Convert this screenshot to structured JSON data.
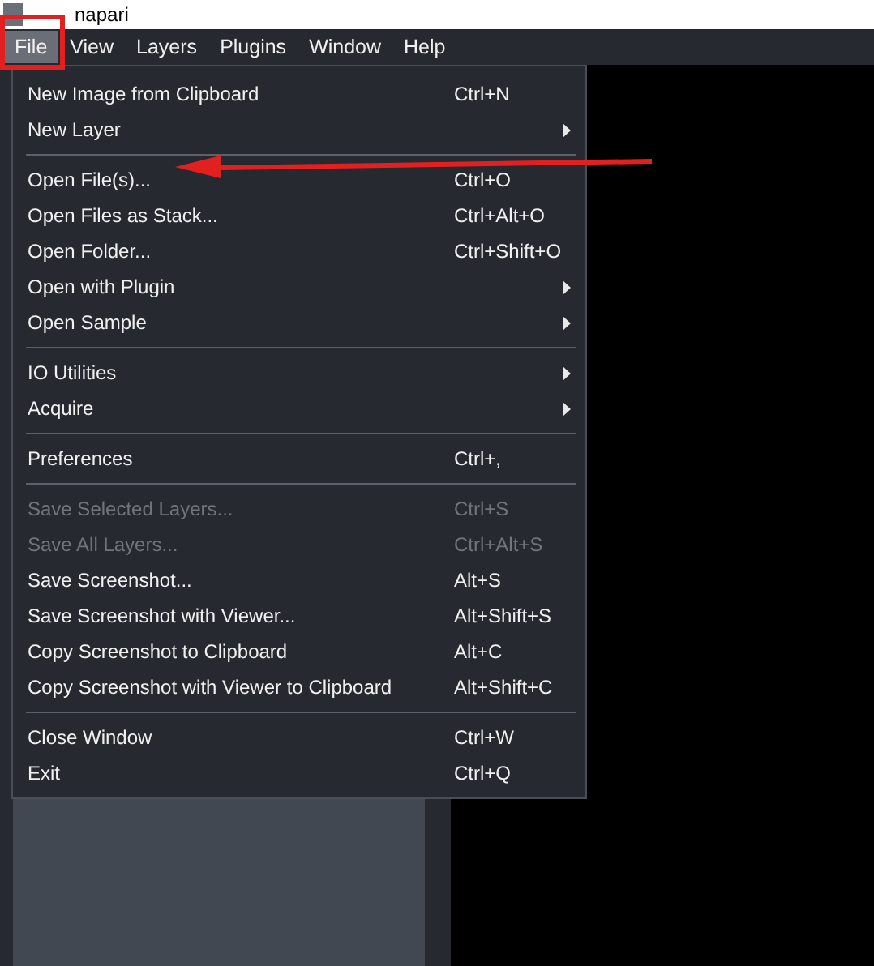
{
  "window": {
    "title": "napari"
  },
  "menu_bar": [
    {
      "label": "File",
      "selected": true
    },
    {
      "label": "View",
      "selected": false
    },
    {
      "label": "Layers",
      "selected": false
    },
    {
      "label": "Plugins",
      "selected": false
    },
    {
      "label": "Window",
      "selected": false
    },
    {
      "label": "Help",
      "selected": false
    }
  ],
  "file_menu": [
    {
      "kind": "item",
      "label": "New Image from Clipboard",
      "shortcut": "Ctrl+N",
      "submenu": false,
      "disabled": false
    },
    {
      "kind": "item",
      "label": "New Layer",
      "submenu": true,
      "disabled": false
    },
    {
      "kind": "separator"
    },
    {
      "kind": "item",
      "label": "Open File(s)...",
      "shortcut": "Ctrl+O",
      "submenu": false,
      "disabled": false
    },
    {
      "kind": "item",
      "label": "Open Files as Stack...",
      "shortcut": "Ctrl+Alt+O",
      "submenu": false,
      "disabled": false
    },
    {
      "kind": "item",
      "label": "Open Folder...",
      "shortcut": "Ctrl+Shift+O",
      "submenu": false,
      "disabled": false
    },
    {
      "kind": "item",
      "label": "Open with Plugin",
      "submenu": true,
      "disabled": false
    },
    {
      "kind": "item",
      "label": "Open Sample",
      "submenu": true,
      "disabled": false
    },
    {
      "kind": "separator"
    },
    {
      "kind": "item",
      "label": "IO Utilities",
      "submenu": true,
      "disabled": false
    },
    {
      "kind": "item",
      "label": "Acquire",
      "submenu": true,
      "disabled": false
    },
    {
      "kind": "separator"
    },
    {
      "kind": "item",
      "label": "Preferences",
      "shortcut": "Ctrl+,",
      "submenu": false,
      "disabled": false
    },
    {
      "kind": "separator"
    },
    {
      "kind": "item",
      "label": "Save Selected Layers...",
      "shortcut": "Ctrl+S",
      "submenu": false,
      "disabled": true
    },
    {
      "kind": "item",
      "label": "Save All Layers...",
      "shortcut": "Ctrl+Alt+S",
      "submenu": false,
      "disabled": true
    },
    {
      "kind": "item",
      "label": "Save Screenshot...",
      "shortcut": "Alt+S",
      "submenu": false,
      "disabled": false
    },
    {
      "kind": "item",
      "label": "Save Screenshot with Viewer...",
      "shortcut": "Alt+Shift+S",
      "submenu": false,
      "disabled": false
    },
    {
      "kind": "item",
      "label": "Copy Screenshot to Clipboard",
      "shortcut": "Alt+C",
      "submenu": false,
      "disabled": false
    },
    {
      "kind": "item",
      "label": "Copy Screenshot with Viewer to Clipboard",
      "shortcut": "Alt+Shift+C",
      "submenu": false,
      "disabled": false
    },
    {
      "kind": "separator"
    },
    {
      "kind": "item",
      "label": "Close Window",
      "shortcut": "Ctrl+W",
      "submenu": false,
      "disabled": false
    },
    {
      "kind": "item",
      "label": "Exit",
      "shortcut": "Ctrl+Q",
      "submenu": false,
      "disabled": false
    }
  ]
}
